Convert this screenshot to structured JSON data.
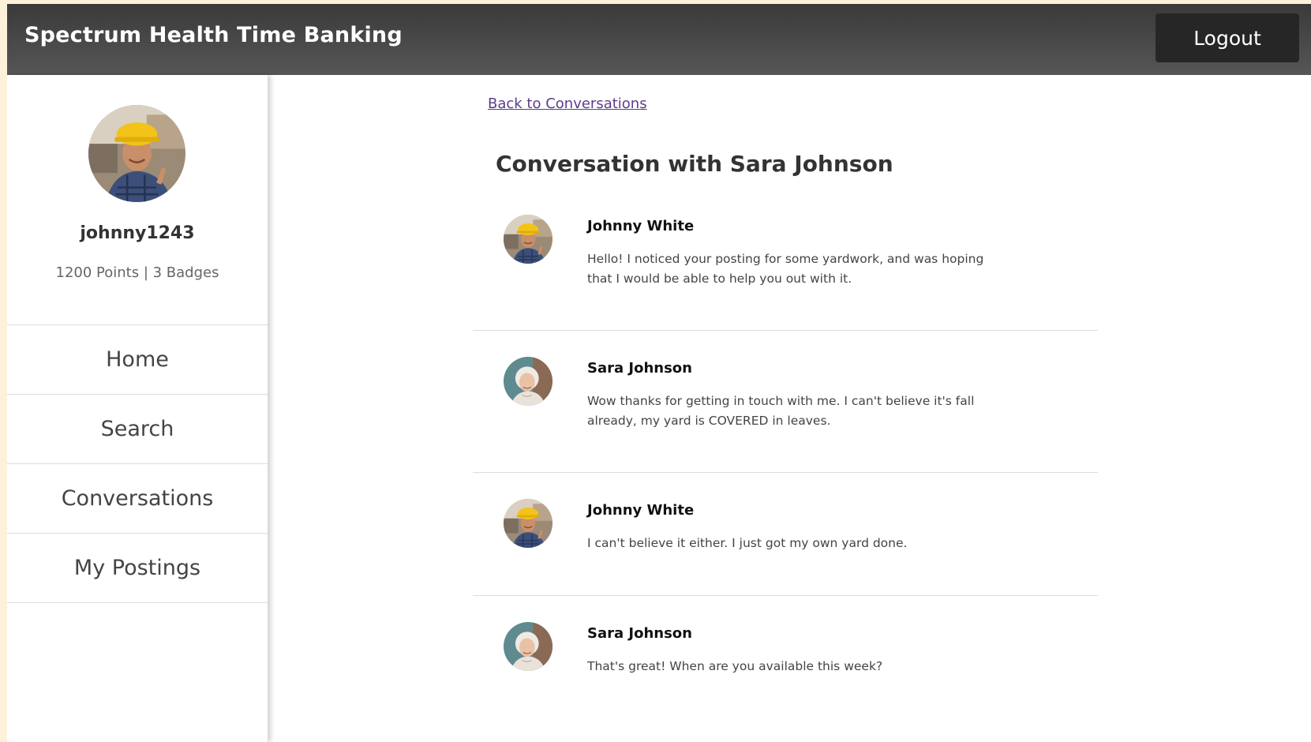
{
  "header": {
    "title": "Spectrum Health Time Banking",
    "logout_label": "Logout"
  },
  "sidebar": {
    "username": "johnny1243",
    "stats": "1200 Points | 3 Badges",
    "nav": [
      {
        "label": "Home",
        "icon": "none"
      },
      {
        "label": "Search",
        "icon": "none"
      },
      {
        "label": "Conversations",
        "icon": "none"
      },
      {
        "label": "My Postings",
        "icon": "none"
      }
    ]
  },
  "main": {
    "back_link": "Back to Conversations",
    "title": "Conversation with Sara Johnson",
    "messages": [
      {
        "sender": "Johnny White",
        "text": "Hello! I noticed your posting for some yardwork, and was hoping that I would be able to help you out with it.",
        "avatar": "construction-worker-photo"
      },
      {
        "sender": "Sara Johnson",
        "text": "Wow thanks for getting in touch with me. I can't believe it's fall already, my yard is COVERED in leaves.",
        "avatar": "elderly-woman-photo"
      },
      {
        "sender": "Johnny White",
        "text": "I can't believe it either. I just got my own yard done.",
        "avatar": "construction-worker-photo"
      },
      {
        "sender": "Sara Johnson",
        "text": "That's great! When are you available this week?",
        "avatar": "elderly-woman-photo"
      }
    ]
  },
  "colors": {
    "header_bg": "#484848",
    "logout_bg": "#262626",
    "link": "#5b3d8a",
    "page_bg": "#fdf1dc"
  }
}
